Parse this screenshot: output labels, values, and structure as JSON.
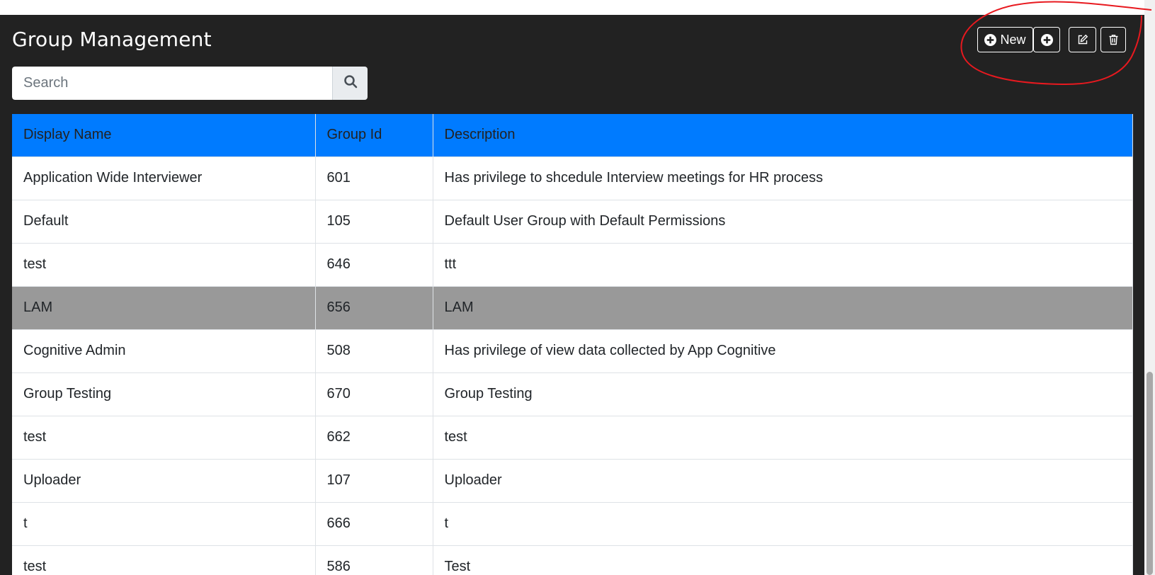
{
  "header": {
    "title": "Group Management"
  },
  "toolbar": {
    "new_label": "New",
    "new_icon": "plus-circle-icon",
    "add_icon": "plus-circle-icon",
    "edit_icon": "edit-icon",
    "delete_icon": "trash-icon"
  },
  "search": {
    "placeholder": "Search",
    "value": "",
    "icon": "search-icon"
  },
  "table": {
    "columns": [
      "Display Name",
      "Group Id",
      "Description"
    ],
    "header_color": "#007bff",
    "selected_row_color": "#999999",
    "rows": [
      {
        "name": "Application Wide Interviewer",
        "id": "601",
        "description": "Has privilege to shcedule Interview meetings for HR process",
        "selected": false
      },
      {
        "name": "Default",
        "id": "105",
        "description": "Default User Group with Default Permissions",
        "selected": false
      },
      {
        "name": "test",
        "id": "646",
        "description": "ttt",
        "selected": false
      },
      {
        "name": "LAM",
        "id": "656",
        "description": "LAM",
        "selected": true
      },
      {
        "name": "Cognitive Admin",
        "id": "508",
        "description": "Has privilege of view data collected by App Cognitive",
        "selected": false
      },
      {
        "name": "Group Testing",
        "id": "670",
        "description": "Group Testing",
        "selected": false
      },
      {
        "name": "test",
        "id": "662",
        "description": "test",
        "selected": false
      },
      {
        "name": "Uploader",
        "id": "107",
        "description": "Uploader",
        "selected": false
      },
      {
        "name": "t",
        "id": "666",
        "description": "t",
        "selected": false
      },
      {
        "name": "test",
        "id": "586",
        "description": "Test",
        "selected": false
      }
    ]
  },
  "colors": {
    "panel_background": "#222222",
    "annotation": "#e8191f"
  }
}
